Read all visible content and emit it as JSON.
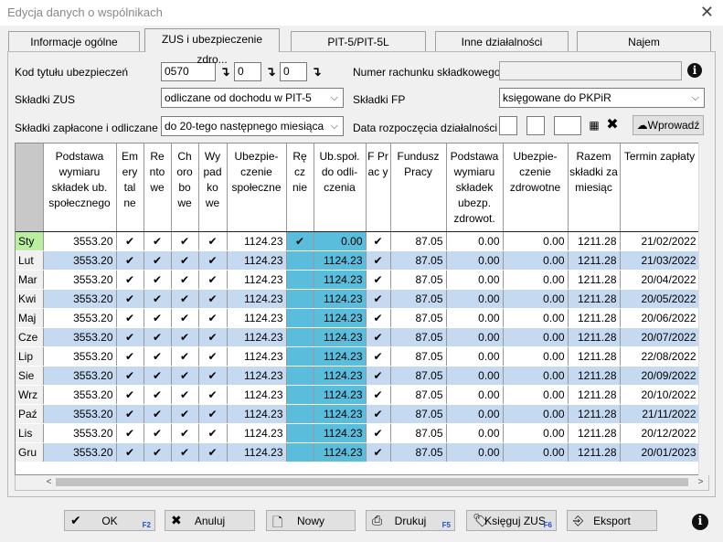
{
  "window": {
    "title": "Edycja danych o wspólnikach",
    "close_glyph": "✕"
  },
  "tabs": [
    {
      "label": "Informacje ogólne"
    },
    {
      "label": "ZUS i ubezpieczenie zdro..."
    },
    {
      "label": "PIT-5/PIT-5L"
    },
    {
      "label": "Inne działalności"
    },
    {
      "label": "Najem"
    }
  ],
  "form": {
    "kod_label": "Kod tytułu ubezpieczeń",
    "kod_value": "0570",
    "kod2": "0",
    "kod3": "0",
    "numer_label": "Numer rachunku składkowego",
    "numer_value": "",
    "skladki_zus_label": "Składki ZUS",
    "skladki_zus_value": "odliczane od dochodu w PIT-5",
    "skladki_fp_label": "Składki FP",
    "skladki_fp_value": "księgowane do PKPiR",
    "zaplacone_label": "Składki zapłacone i odliczane",
    "zaplacone_value": "do 20-tego następnego miesiąca",
    "data_label": "Data rozpoczęcia działalności",
    "wprowadz_label": "Wprowadź"
  },
  "table": {
    "headers": [
      "",
      "Podstawa wymiaru składek ub. społecznego",
      "Em ery tal ne",
      "Re nto we",
      "Ch oro bo we",
      "Wy pad ko we",
      "Ubezpie- czenie społeczne",
      "Rę cz nie",
      "Ub.społ. do odli- czenia",
      "F Pr ac y",
      "Fundusz Pracy",
      "Podstawa wymiaru składek ubezp. zdrowot.",
      "Ubezpie- czenie zdrowotne",
      "Razem składki za miesiąc",
      "Termin zapłaty"
    ],
    "rows": [
      {
        "month": "Sty",
        "podstawa": "3553.20",
        "ubezp": "1124.23",
        "reczne": true,
        "ubspol": "0.00",
        "fundusz": "87.05",
        "podzdr": "0.00",
        "zdrow": "0.00",
        "razem": "1211.28",
        "termin": "21/02/2022"
      },
      {
        "month": "Lut",
        "podstawa": "3553.20",
        "ubezp": "1124.23",
        "reczne": false,
        "ubspol": "1124.23",
        "fundusz": "87.05",
        "podzdr": "0.00",
        "zdrow": "0.00",
        "razem": "1211.28",
        "termin": "21/03/2022"
      },
      {
        "month": "Mar",
        "podstawa": "3553.20",
        "ubezp": "1124.23",
        "reczne": false,
        "ubspol": "1124.23",
        "fundusz": "87.05",
        "podzdr": "0.00",
        "zdrow": "0.00",
        "razem": "1211.28",
        "termin": "20/04/2022"
      },
      {
        "month": "Kwi",
        "podstawa": "3553.20",
        "ubezp": "1124.23",
        "reczne": false,
        "ubspol": "1124.23",
        "fundusz": "87.05",
        "podzdr": "0.00",
        "zdrow": "0.00",
        "razem": "1211.28",
        "termin": "20/05/2022"
      },
      {
        "month": "Maj",
        "podstawa": "3553.20",
        "ubezp": "1124.23",
        "reczne": false,
        "ubspol": "1124.23",
        "fundusz": "87.05",
        "podzdr": "0.00",
        "zdrow": "0.00",
        "razem": "1211.28",
        "termin": "20/06/2022"
      },
      {
        "month": "Cze",
        "podstawa": "3553.20",
        "ubezp": "1124.23",
        "reczne": false,
        "ubspol": "1124.23",
        "fundusz": "87.05",
        "podzdr": "0.00",
        "zdrow": "0.00",
        "razem": "1211.28",
        "termin": "20/07/2022"
      },
      {
        "month": "Lip",
        "podstawa": "3553.20",
        "ubezp": "1124.23",
        "reczne": false,
        "ubspol": "1124.23",
        "fundusz": "87.05",
        "podzdr": "0.00",
        "zdrow": "0.00",
        "razem": "1211.28",
        "termin": "22/08/2022"
      },
      {
        "month": "Sie",
        "podstawa": "3553.20",
        "ubezp": "1124.23",
        "reczne": false,
        "ubspol": "1124.23",
        "fundusz": "87.05",
        "podzdr": "0.00",
        "zdrow": "0.00",
        "razem": "1211.28",
        "termin": "20/09/2022"
      },
      {
        "month": "Wrz",
        "podstawa": "3553.20",
        "ubezp": "1124.23",
        "reczne": false,
        "ubspol": "1124.23",
        "fundusz": "87.05",
        "podzdr": "0.00",
        "zdrow": "0.00",
        "razem": "1211.28",
        "termin": "20/10/2022"
      },
      {
        "month": "Paź",
        "podstawa": "3553.20",
        "ubezp": "1124.23",
        "reczne": false,
        "ubspol": "1124.23",
        "fundusz": "87.05",
        "podzdr": "0.00",
        "zdrow": "0.00",
        "razem": "1211.28",
        "termin": "21/11/2022"
      },
      {
        "month": "Lis",
        "podstawa": "3553.20",
        "ubezp": "1124.23",
        "reczne": false,
        "ubspol": "1124.23",
        "fundusz": "87.05",
        "podzdr": "0.00",
        "zdrow": "0.00",
        "razem": "1211.28",
        "termin": "20/12/2022"
      },
      {
        "month": "Gru",
        "podstawa": "3553.20",
        "ubezp": "1124.23",
        "reczne": false,
        "ubspol": "1124.23",
        "fundusz": "87.05",
        "podzdr": "0.00",
        "zdrow": "0.00",
        "razem": "1211.28",
        "termin": "20/01/2023"
      }
    ]
  },
  "buttons": {
    "ok": {
      "label": "OK",
      "shortcut": "F2"
    },
    "anuluj": {
      "label": "Anuluj"
    },
    "nowy": {
      "label": "Nowy"
    },
    "drukuj": {
      "label": "Drukuj",
      "shortcut": "F5"
    },
    "ksieguj": {
      "label": "Księguj ZUS",
      "shortcut": "F6"
    },
    "eksport": {
      "label": "Eksport"
    }
  },
  "colors": {
    "row_alt": "#c5d9f1",
    "cyan": "#5bbddc",
    "selected_month": "#b8f0a0",
    "shortcut": "#1a4fd6"
  },
  "icons": {
    "close": "close-icon",
    "info": "info-icon",
    "arrow": "arrow-down-icon",
    "calendar": "calendar-icon",
    "clear": "clear-icon",
    "cloud": "cloud-download-icon",
    "ok": "check-icon",
    "anuluj": "cross-icon",
    "nowy": "new-document-icon",
    "drukuj": "printer-icon",
    "ksieguj": "tag-icon",
    "eksport": "export-icon"
  }
}
